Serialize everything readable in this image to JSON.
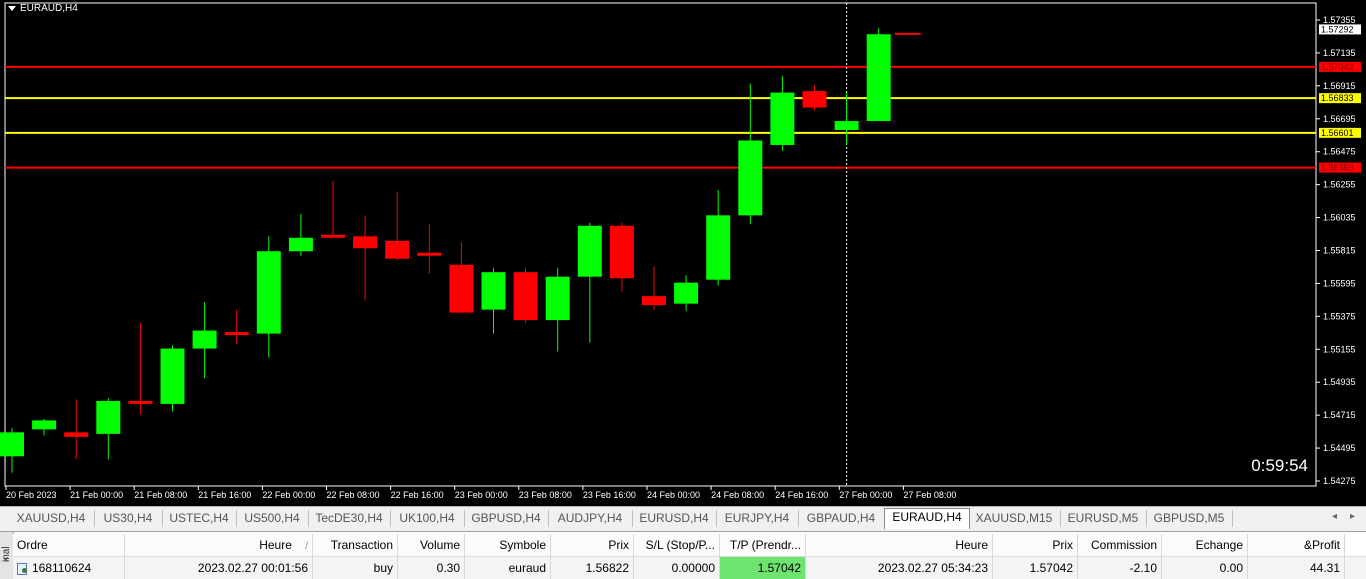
{
  "chart": {
    "title": "EURAUD,H4",
    "timer": "0:59:54",
    "colors": {
      "bull": "#00ff00",
      "bear": "#ff0000",
      "line_red": "#ff0000",
      "line_yellow": "#ffff00",
      "bg": "#000000",
      "axis_text": "#ffffff"
    }
  },
  "chart_data": {
    "type": "candlestick",
    "symbol": "EURAUD",
    "timeframe": "H4",
    "ylim": [
      1.5427,
      1.57355
    ],
    "y_ticks": [
      "1.57355",
      "1.57135",
      "1.56915",
      "1.56695",
      "1.56475",
      "1.56255",
      "1.56035",
      "1.55815",
      "1.55595",
      "1.55375",
      "1.55155",
      "1.54935",
      "1.54715",
      "1.54495",
      "1.54275"
    ],
    "x_ticks": [
      "20 Feb 2023",
      "21 Feb 00:00",
      "21 Feb 08:00",
      "21 Feb 16:00",
      "22 Feb 00:00",
      "22 Feb 08:00",
      "22 Feb 16:00",
      "23 Feb 00:00",
      "23 Feb 08:00",
      "23 Feb 16:00",
      "24 Feb 00:00",
      "24 Feb 08:00",
      "24 Feb 16:00",
      "27 Feb 00:00",
      "27 Feb 08:00"
    ],
    "candles": [
      {
        "o": 1.5444,
        "h": 1.5463,
        "l": 1.5433,
        "c": 1.546
      },
      {
        "o": 1.5462,
        "h": 1.5469,
        "l": 1.5458,
        "c": 1.5468
      },
      {
        "o": 1.546,
        "h": 1.5482,
        "l": 1.5442,
        "c": 1.5457
      },
      {
        "o": 1.5459,
        "h": 1.5483,
        "l": 1.5442,
        "c": 1.5481
      },
      {
        "o": 1.5481,
        "h": 1.5533,
        "l": 1.5472,
        "c": 1.5479
      },
      {
        "o": 1.5479,
        "h": 1.5518,
        "l": 1.5474,
        "c": 1.5516
      },
      {
        "o": 1.5516,
        "h": 1.5547,
        "l": 1.5496,
        "c": 1.5528
      },
      {
        "o": 1.5527,
        "h": 1.5542,
        "l": 1.5519,
        "c": 1.5525
      },
      {
        "o": 1.5526,
        "h": 1.5591,
        "l": 1.551,
        "c": 1.5581
      },
      {
        "o": 1.5581,
        "h": 1.5606,
        "l": 1.5578,
        "c": 1.559
      },
      {
        "o": 1.5592,
        "h": 1.5628,
        "l": 1.5591,
        "c": 1.559
      },
      {
        "o": 1.5591,
        "h": 1.5605,
        "l": 1.5548,
        "c": 1.5583
      },
      {
        "o": 1.5588,
        "h": 1.5621,
        "l": 1.5575,
        "c": 1.5576
      },
      {
        "o": 1.558,
        "h": 1.5599,
        "l": 1.5566,
        "c": 1.5578
      },
      {
        "o": 1.5572,
        "h": 1.5587,
        "l": 1.554,
        "c": 1.554
      },
      {
        "o": 1.5542,
        "h": 1.557,
        "l": 1.5526,
        "c": 1.5567
      },
      {
        "o": 1.5567,
        "h": 1.557,
        "l": 1.5533,
        "c": 1.5535
      },
      {
        "o": 1.5535,
        "h": 1.557,
        "l": 1.5514,
        "c": 1.5564
      },
      {
        "o": 1.5564,
        "h": 1.56,
        "l": 1.552,
        "c": 1.5598
      },
      {
        "o": 1.5598,
        "h": 1.56,
        "l": 1.5554,
        "c": 1.5563
      },
      {
        "o": 1.5551,
        "h": 1.5571,
        "l": 1.5542,
        "c": 1.5545
      },
      {
        "o": 1.5546,
        "h": 1.5565,
        "l": 1.5541,
        "c": 1.556
      },
      {
        "o": 1.5562,
        "h": 1.5622,
        "l": 1.5558,
        "c": 1.5605
      },
      {
        "o": 1.5605,
        "h": 1.5693,
        "l": 1.5599,
        "c": 1.5655
      },
      {
        "o": 1.5652,
        "h": 1.5698,
        "l": 1.5648,
        "c": 1.5687
      },
      {
        "o": 1.5688,
        "h": 1.5692,
        "l": 1.5675,
        "c": 1.5677
      },
      {
        "o": 1.5662,
        "h": 1.5687,
        "l": 1.5652,
        "c": 1.5668
      },
      {
        "o": 1.5668,
        "h": 1.573,
        "l": 1.5668,
        "c": 1.5726
      }
    ],
    "current_price": 1.57262,
    "horizontal_lines": [
      {
        "value": 1.57042,
        "color": "red",
        "label": "1.57042"
      },
      {
        "value": 1.56833,
        "color": "yellow",
        "label": "1.56833"
      },
      {
        "value": 1.56601,
        "color": "yellow",
        "label": "1.56601"
      },
      {
        "value": 1.56369,
        "color": "red",
        "label": "1.56369"
      }
    ],
    "price_label": "1.57292",
    "crosshair_x_candle": 26
  },
  "tabs": {
    "items": [
      "XAUUSD,H4",
      "US30,H4",
      "USTEC,H4",
      "US500,H4",
      "TecDE30,H4",
      "UK100,H4",
      "GBPUSD,H4",
      "AUDJPY,H4",
      "EURUSD,H4",
      "EURJPY,H4",
      "GBPAUD,H4",
      "EURAUD,H4",
      "XAUUSD,M15",
      "EURUSD,M5",
      "GBPUSD,M5"
    ],
    "active": "EURAUD,H4",
    "left_arrow": "◂",
    "right_arrow": "▸"
  },
  "terminal": {
    "side_label": "inal",
    "close": "×",
    "headers": [
      "Ordre",
      "Heure",
      "Transaction",
      "Volume",
      "Symbole",
      "Prix",
      "S/L (Stop/P...",
      "T/P (Prendr...",
      "Heure",
      "Prix",
      "Commission",
      "Echange",
      "&Profit"
    ],
    "sort_indicator": "/",
    "row": {
      "order": "168110624",
      "open_time": "2023.02.27 00:01:56",
      "type": "buy",
      "volume": "0.30",
      "symbol": "euraud",
      "open_price": "1.56822",
      "sl": "0.00000",
      "tp": "1.57042",
      "time": "2023.02.27 05:34:23",
      "price": "1.57042",
      "commission": "-2.10",
      "swap": "0.00",
      "profit": "44.31"
    }
  }
}
